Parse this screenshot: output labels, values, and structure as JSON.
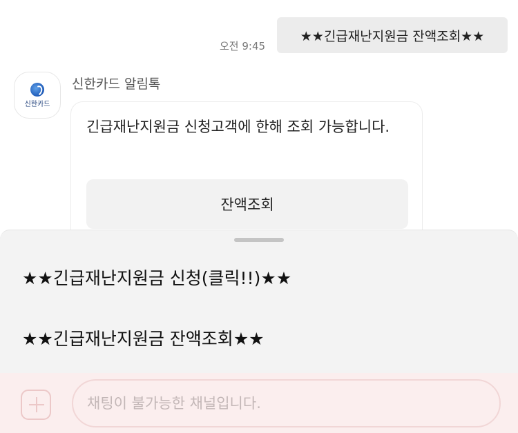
{
  "chat": {
    "outgoing": {
      "time": "오전 9:45",
      "text": "★★긴급재난지원금 잔액조회★★"
    },
    "incoming": {
      "sender": "신한카드 알림톡",
      "avatar_text": "신한카드",
      "message": "긴급재난지원금 신청고객에 한해 조회 가능합니다.",
      "button_label": "잔액조회"
    }
  },
  "sheet": {
    "items": [
      {
        "label": "★★긴급재난지원금 신청(클릭!!)★★"
      },
      {
        "label": "★★긴급재난지원금 잔액조회★★"
      }
    ]
  },
  "input": {
    "placeholder": "채팅이 불가능한 채널입니다."
  },
  "icons": {
    "plus": "plus-icon",
    "logo": "shinhan-logo-icon"
  },
  "colors": {
    "input_bar_bg": "#fbeeee",
    "bubble_out_bg": "#ececec",
    "sheet_bg": "#f3f3f3"
  }
}
